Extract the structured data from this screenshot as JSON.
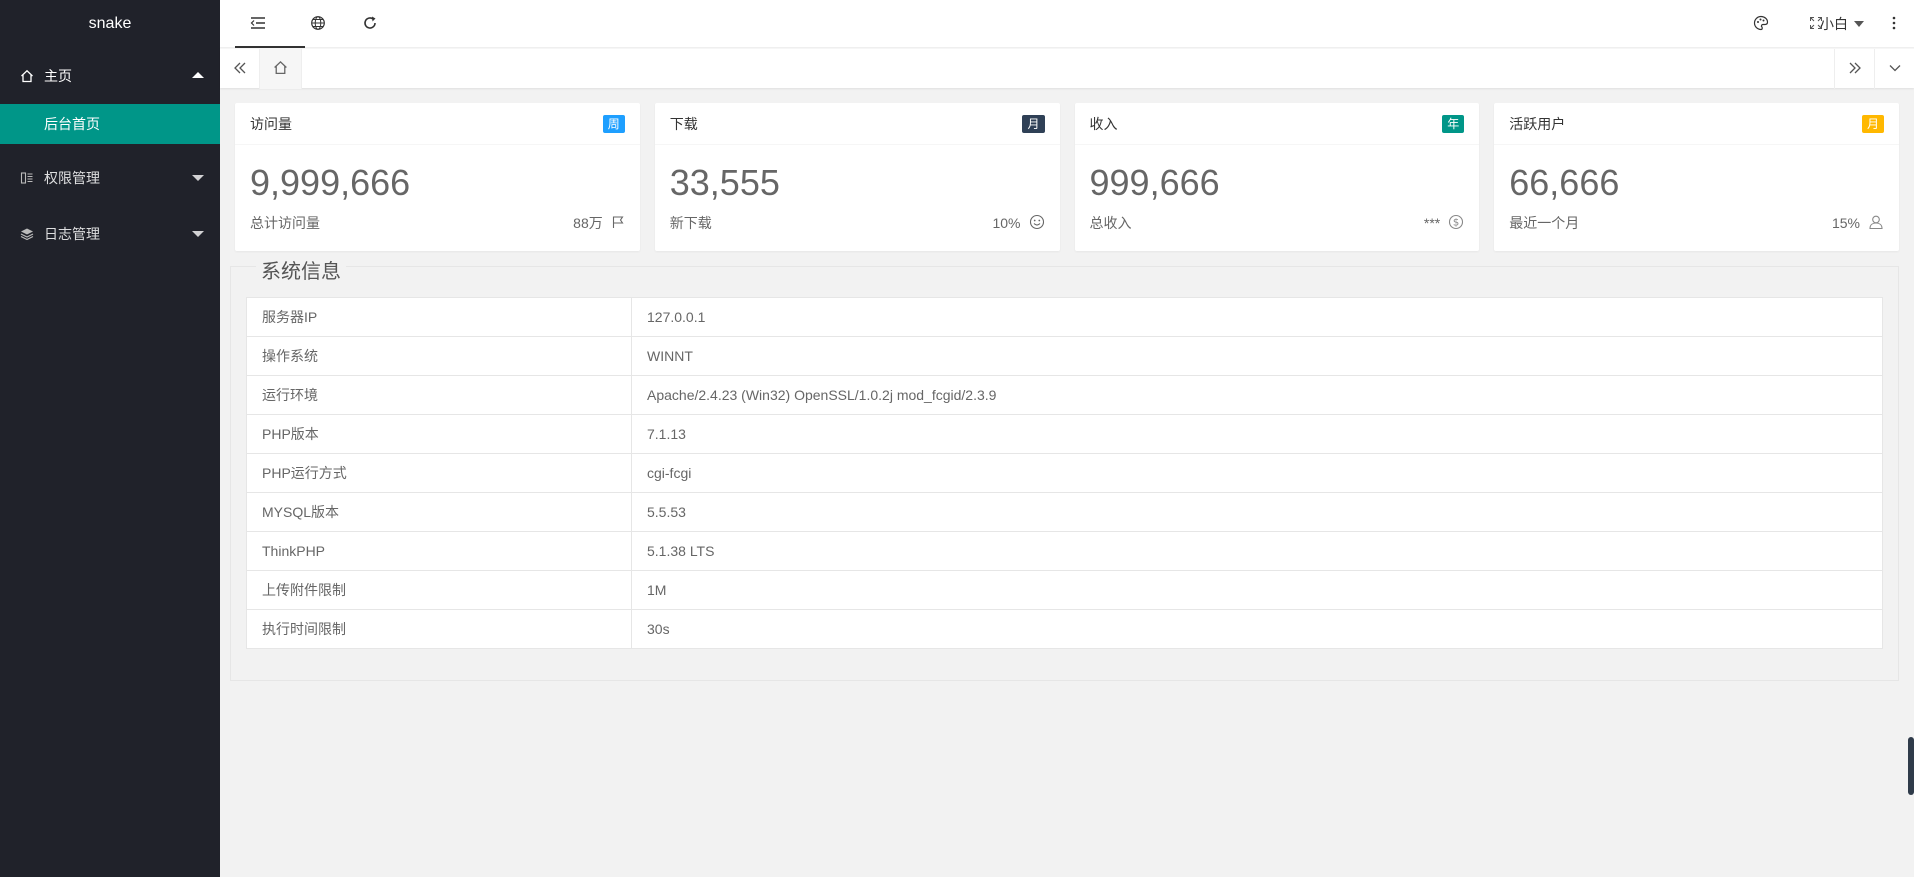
{
  "app": {
    "title": "snake"
  },
  "sidebar": {
    "items": [
      {
        "label": "主页",
        "icon": "home-icon",
        "expanded": true,
        "children": [
          {
            "label": "后台首页",
            "active": true
          }
        ]
      },
      {
        "label": "权限管理",
        "icon": "permission-icon",
        "expanded": false
      },
      {
        "label": "日志管理",
        "icon": "layers-icon",
        "expanded": false
      }
    ]
  },
  "header": {
    "buttons": [
      "menu-fold-icon",
      "globe-icon",
      "refresh-icon"
    ],
    "right_icons": [
      "theme-palette-icon",
      "fullscreen-icon",
      "more-vertical-icon"
    ],
    "user": "小白"
  },
  "tabs": {
    "home_icon": "home-icon"
  },
  "cards": [
    {
      "title": "访问量",
      "badge": "周",
      "badge_color": "#1e9fff",
      "value": "9,999,666",
      "label": "总计访问量",
      "stat": "88万",
      "stat_icon": "flag-icon"
    },
    {
      "title": "下载",
      "badge": "月",
      "badge_color": "#2f4056",
      "value": "33,555",
      "label": "新下载",
      "stat": "10%",
      "stat_icon": "smile-icon"
    },
    {
      "title": "收入",
      "badge": "年",
      "badge_color": "#009688",
      "value": "999,666",
      "label": "总收入",
      "stat": "***",
      "stat_icon": "dollar-icon"
    },
    {
      "title": "活跃用户",
      "badge": "月",
      "badge_color": "#ffb800",
      "value": "66,666",
      "label": "最近一个月",
      "stat": "15%",
      "stat_icon": "user-icon"
    }
  ],
  "system": {
    "legend": "系统信息",
    "rows": [
      {
        "key": "服务器IP",
        "value": "127.0.0.1"
      },
      {
        "key": "操作系统",
        "value": "WINNT"
      },
      {
        "key": "运行环境",
        "value": "Apache/2.4.23 (Win32) OpenSSL/1.0.2j mod_fcgid/2.3.9"
      },
      {
        "key": "PHP版本",
        "value": "7.1.13"
      },
      {
        "key": "PHP运行方式",
        "value": "cgi-fcgi"
      },
      {
        "key": "MYSQL版本",
        "value": "5.5.53"
      },
      {
        "key": "ThinkPHP",
        "value": "5.1.38 LTS"
      },
      {
        "key": "上传附件限制",
        "value": "1M"
      },
      {
        "key": "执行时间限制",
        "value": "30s"
      }
    ]
  }
}
